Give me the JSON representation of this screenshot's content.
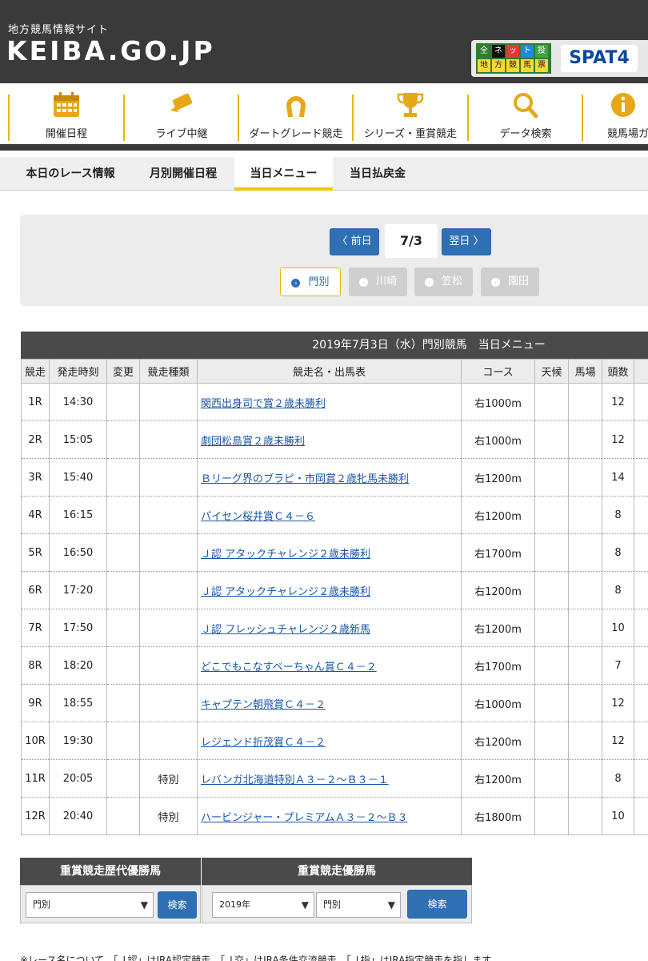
{
  "header": {
    "subtitle": "地方競馬情報サイト",
    "logo": "KEIBA.GO.JP",
    "netbox_cells": [
      "全",
      "ネ",
      "ッ",
      "ト",
      "投",
      "票",
      "地",
      "方",
      "競",
      "馬"
    ],
    "spat4": "SPAT4"
  },
  "icon_nav": [
    {
      "label": "開催日程",
      "icon": "calendar-icon"
    },
    {
      "label": "ライブ中継",
      "icon": "camera-icon"
    },
    {
      "label": "ダートグレード競走",
      "icon": "horseshoe-icon"
    },
    {
      "label": "シリーズ・重賞競走",
      "icon": "trophy-icon"
    },
    {
      "label": "データ検索",
      "icon": "search-icon"
    },
    {
      "label": "競馬場ガ",
      "icon": "info-icon"
    }
  ],
  "tabs": [
    {
      "label": "本日のレース情報"
    },
    {
      "label": "月別開催日程"
    },
    {
      "label": "当日メニュー"
    },
    {
      "label": "当日払戻金"
    }
  ],
  "date_nav": {
    "prev": "前日",
    "current": "7/3",
    "next": "翌日",
    "venues": [
      {
        "label": "門別",
        "active": true
      },
      {
        "label": "川崎",
        "active": false
      },
      {
        "label": "笠松",
        "active": false
      },
      {
        "label": "園田",
        "active": false
      }
    ]
  },
  "race_table": {
    "title": "2019年7月3日（水）門別競馬　当日メニュー",
    "headers": [
      "競走",
      "発走時刻",
      "変更",
      "競走種類",
      "競走名・出馬表",
      "コース",
      "天候",
      "馬場",
      "頭数"
    ],
    "rows": [
      {
        "race": "1R",
        "time": "14:30",
        "change": "",
        "type": "",
        "name": "関西出身司で賞２歳未勝利",
        "course": "右1000m",
        "weather": "",
        "track": "",
        "runners": "12"
      },
      {
        "race": "2R",
        "time": "15:05",
        "change": "",
        "type": "",
        "name": "劇団松島賞２歳未勝利",
        "course": "右1000m",
        "weather": "",
        "track": "",
        "runners": "12"
      },
      {
        "race": "3R",
        "time": "15:40",
        "change": "",
        "type": "",
        "name": "Ｂリーグ界のブラピ・市岡賞２歳牝馬未勝利",
        "course": "右1200m",
        "weather": "",
        "track": "",
        "runners": "14"
      },
      {
        "race": "4R",
        "time": "16:15",
        "change": "",
        "type": "",
        "name": "パイセン桜井賞Ｃ４－６",
        "course": "右1200m",
        "weather": "",
        "track": "",
        "runners": "8"
      },
      {
        "race": "5R",
        "time": "16:50",
        "change": "",
        "type": "",
        "name": "Ｊ認 アタックチャレンジ２歳未勝利",
        "course": "右1700m",
        "weather": "",
        "track": "",
        "runners": "8"
      },
      {
        "race": "6R",
        "time": "17:20",
        "change": "",
        "type": "",
        "name": "Ｊ認 アタックチャレンジ２歳未勝利",
        "course": "右1200m",
        "weather": "",
        "track": "",
        "runners": "8"
      },
      {
        "race": "7R",
        "time": "17:50",
        "change": "",
        "type": "",
        "name": "Ｊ認 フレッシュチャレンジ２歳新馬",
        "course": "右1200m",
        "weather": "",
        "track": "",
        "runners": "10"
      },
      {
        "race": "8R",
        "time": "18:20",
        "change": "",
        "type": "",
        "name": "どこでもこなすベーちゃん賞Ｃ４－２",
        "course": "右1700m",
        "weather": "",
        "track": "",
        "runners": "7"
      },
      {
        "race": "9R",
        "time": "18:55",
        "change": "",
        "type": "",
        "name": "キャプテン朝飛賞Ｃ４－２",
        "course": "右1000m",
        "weather": "",
        "track": "",
        "runners": "12"
      },
      {
        "race": "10R",
        "time": "19:30",
        "change": "",
        "type": "",
        "name": "レジェンド折茂賞Ｃ４－２",
        "course": "右1200m",
        "weather": "",
        "track": "",
        "runners": "12"
      },
      {
        "race": "11R",
        "time": "20:05",
        "change": "",
        "type": "特別",
        "name": "レバンガ北海道特別Ａ３－２～Ｂ３－１",
        "course": "右1200m",
        "weather": "",
        "track": "",
        "runners": "8"
      },
      {
        "race": "12R",
        "time": "20:40",
        "change": "",
        "type": "特別",
        "name": "ハービンジャー・プレミアムＡ３－２～Ｂ３",
        "course": "右1800m",
        "weather": "",
        "track": "",
        "runners": "10"
      }
    ]
  },
  "search_history": {
    "title": "重賞競走歴代優勝馬",
    "venue_select": "門別",
    "button": "検索"
  },
  "search_winners": {
    "title": "重賞競走優勝馬",
    "year_select": "2019年",
    "venue_select": "門別",
    "button": "検索"
  },
  "footnote": "※レース名について、「Ｊ認」はJRA認定競走、「Ｊ交」はJRA条件交流競走、「Ｊ指」はJRA指定競走を指します。"
}
